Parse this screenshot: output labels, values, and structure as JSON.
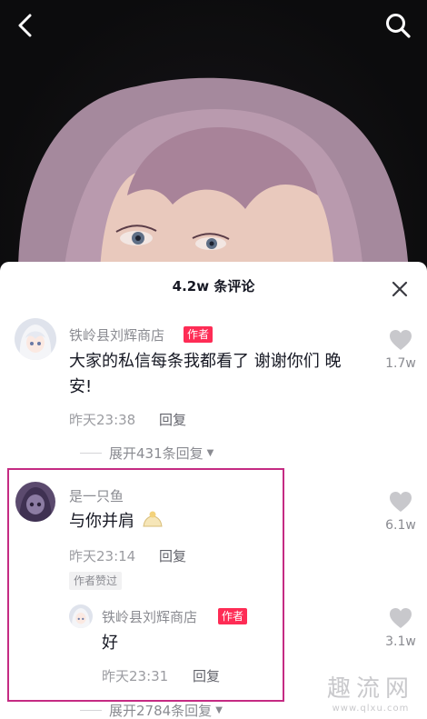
{
  "header": {
    "back_icon": "chevron-left-icon",
    "search_icon": "search-icon"
  },
  "sheet": {
    "title": "4.2w 条评论",
    "close_icon": "close-icon"
  },
  "comments": [
    {
      "name": "铁岭县刘辉商店",
      "badge": "作者",
      "text_line1": "大家的私信每条我都看了 谢谢你们 晚",
      "text_line2": "安!",
      "time": "昨天23:38",
      "reply_label": "回复",
      "like_count": "1.7w",
      "expand_label": "展开431条回复"
    },
    {
      "name": "是一只鱼",
      "text": "与你并肩",
      "emoji_icon": "shoulder-emoji-icon",
      "time": "昨天23:14",
      "reply_label": "回复",
      "liked_by_author": "作者赞过",
      "like_count": "6.1w",
      "reply": {
        "name": "铁岭县刘辉商店",
        "badge": "作者",
        "text": "好",
        "time": "昨天23:31",
        "reply_label": "回复",
        "like_count": "3.1w"
      },
      "expand_label": "展开2784条回复"
    }
  ],
  "watermark": {
    "big": "趣流网",
    "small": "www.qlxu.com"
  },
  "colors": {
    "badge": "#fe2c55",
    "highlight_border": "#c52b83"
  }
}
